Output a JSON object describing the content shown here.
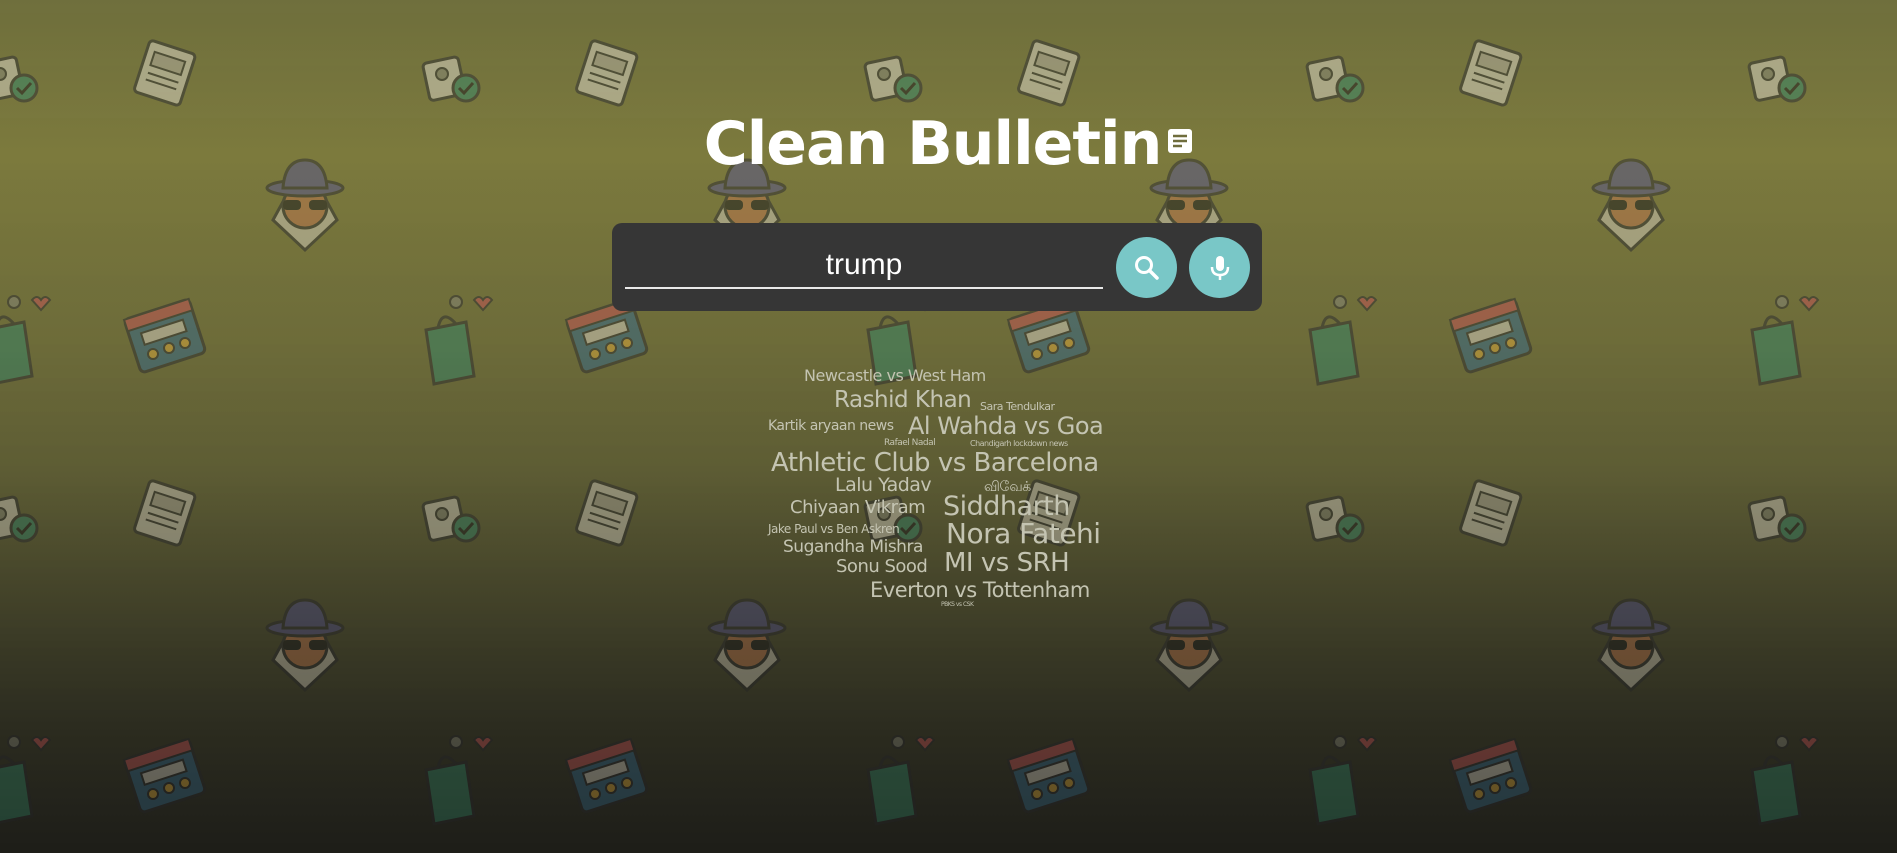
{
  "header": {
    "title": "Clean Bulletin",
    "title_icon": "article-icon"
  },
  "search": {
    "value": "trump",
    "placeholder": "",
    "search_icon": "search-icon",
    "mic_icon": "mic-icon"
  },
  "word_cloud": {
    "words": [
      "Newcastle vs West Ham",
      "Rashid Khan",
      "Sara Tendulkar",
      "Kartik aryaan news",
      "Al Wahda vs Goa",
      "Rafael Nadal",
      "Chandigarh lockdown news",
      "Athletic Club vs Barcelona",
      "Lalu Yadav",
      "விவேக்",
      "Chiyaan Vikram",
      "Siddharth",
      "Jake Paul vs Ben Askren",
      "Nora Fatehi",
      "Sugandha Mishra",
      "Sonu Sood",
      "MI vs SRH",
      "Everton vs Tottenham",
      "PBKS vs CSK"
    ]
  },
  "colors": {
    "accent": "#79c7c7",
    "panel": "#363636",
    "title": "#ffffff",
    "cloud_text": "#c4c4b2"
  },
  "background_icons": [
    "fake-news-newspaper-icon",
    "verified-photo-icon",
    "spy-detective-icon",
    "shopping-bag-icon",
    "review-browser-icon"
  ]
}
